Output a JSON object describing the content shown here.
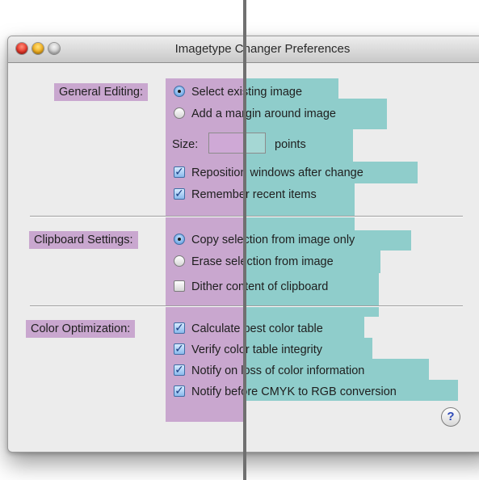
{
  "window": {
    "title": "Imagetype Changer Preferences"
  },
  "sections": [
    {
      "label": "General Editing:",
      "options": [
        {
          "type": "radio",
          "label": "Select existing image",
          "checked": true
        },
        {
          "type": "radio",
          "label": "Add a margin around image",
          "checked": false
        }
      ],
      "size_field": {
        "label": "Size:",
        "value": "",
        "unit": "points"
      },
      "checkboxes": [
        {
          "label": "Reposition windows after change",
          "checked": true
        },
        {
          "label": "Remember recent items",
          "checked": true
        }
      ]
    },
    {
      "label": "Clipboard Settings:",
      "options": [
        {
          "type": "radio",
          "label": "Copy selection from image only",
          "checked": true
        },
        {
          "type": "radio",
          "label": "Erase selection from image",
          "checked": false
        }
      ],
      "checkboxes": [
        {
          "label": "Dither content of clipboard",
          "checked": false
        }
      ]
    },
    {
      "label": "Color Optimization:",
      "checkboxes": [
        {
          "label": "Calculate best color table",
          "checked": true
        },
        {
          "label": "Verify color table integrity",
          "checked": true
        },
        {
          "label": "Notify on loss of color information",
          "checked": true
        },
        {
          "label": "Notify before CMYK to RGB conversion",
          "checked": true
        }
      ]
    }
  ],
  "help_button": {
    "glyph": "?"
  },
  "colors": {
    "label_highlight": "#c9a7cf",
    "control_highlight": "#8fcdcb",
    "window_bg": "#ececec"
  },
  "icons": [
    "close-light-icon",
    "minimize-light-icon",
    "zoom-light-icon",
    "help-icon"
  ]
}
